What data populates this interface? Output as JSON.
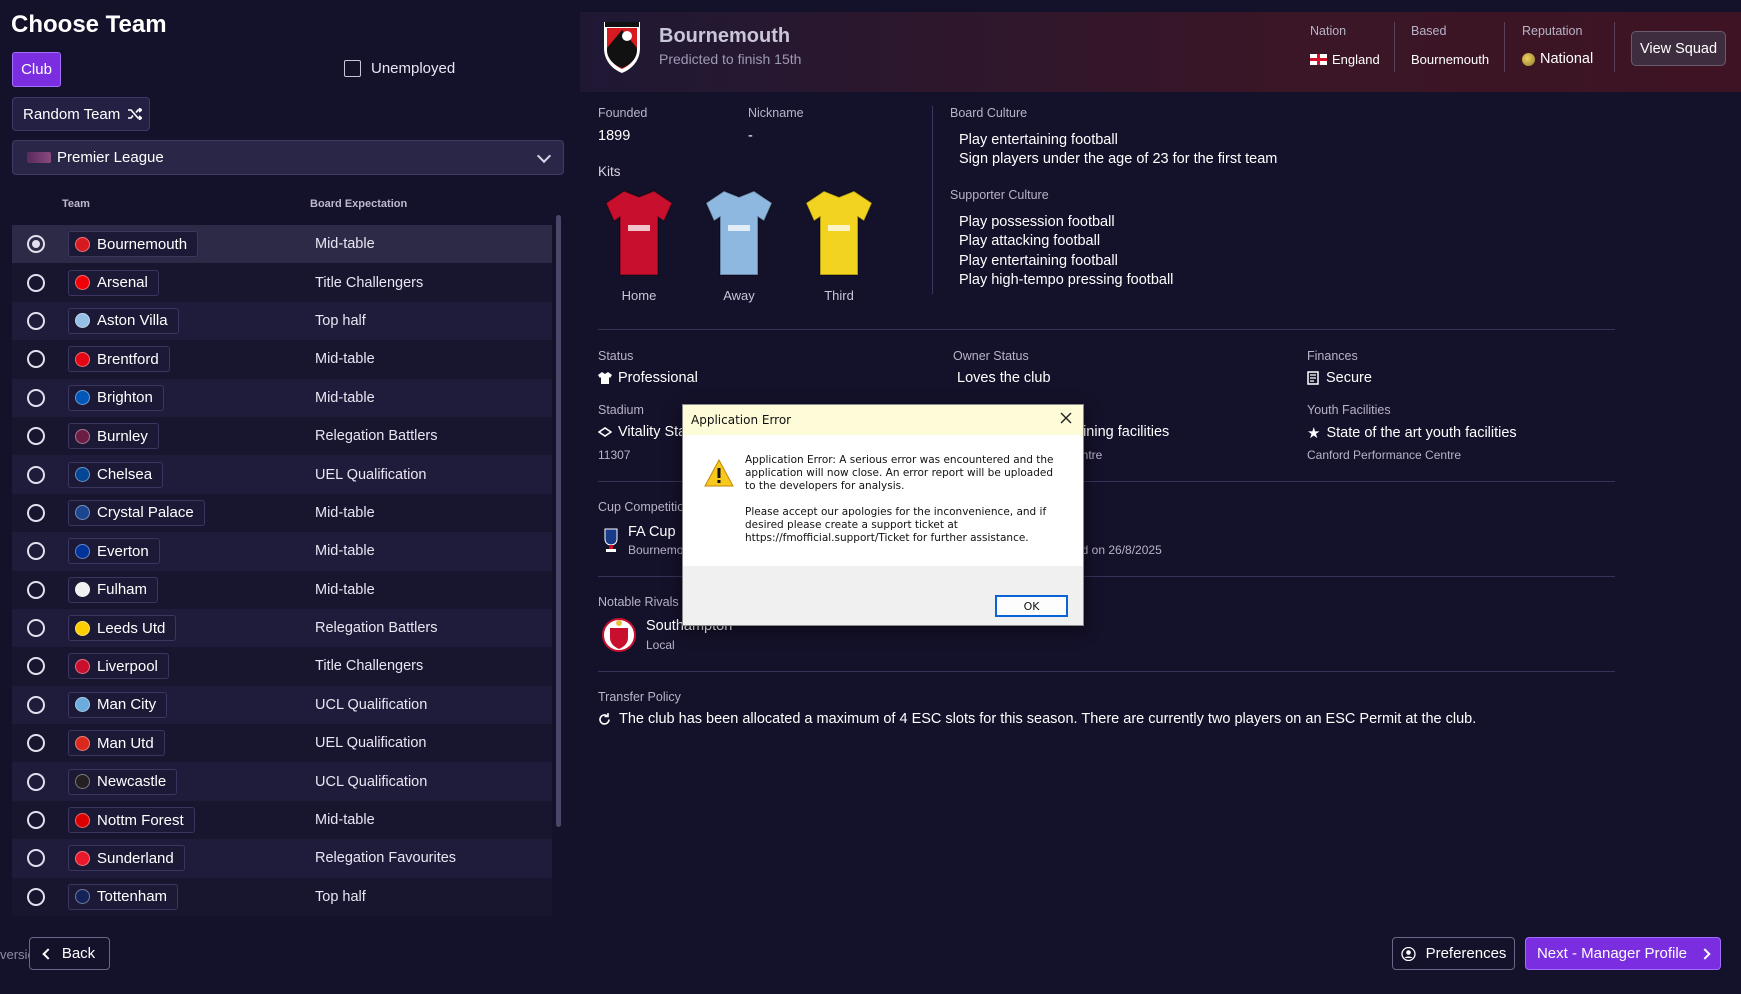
{
  "left": {
    "title": "Choose Team",
    "club_button": "Club",
    "unemployed_label": "Unemployed",
    "random_team_label": "Random Team",
    "league": "Premier League",
    "columns": {
      "team": "Team",
      "expectation": "Board Expectation"
    },
    "teams": [
      {
        "name": "Bournemouth",
        "expectation": "Mid-table",
        "color": "#d71920",
        "selected": true
      },
      {
        "name": "Arsenal",
        "expectation": "Title Challengers",
        "color": "#ef0107"
      },
      {
        "name": "Aston Villa",
        "expectation": "Top half",
        "color": "#95bfe5"
      },
      {
        "name": "Brentford",
        "expectation": "Mid-table",
        "color": "#e30613"
      },
      {
        "name": "Brighton",
        "expectation": "Mid-table",
        "color": "#0057b8"
      },
      {
        "name": "Burnley",
        "expectation": "Relegation Battlers",
        "color": "#6c1d45"
      },
      {
        "name": "Chelsea",
        "expectation": "UEL Qualification",
        "color": "#034694"
      },
      {
        "name": "Crystal Palace",
        "expectation": "Mid-table",
        "color": "#1b458f"
      },
      {
        "name": "Everton",
        "expectation": "Mid-table",
        "color": "#003399"
      },
      {
        "name": "Fulham",
        "expectation": "Mid-table",
        "color": "#f0f0f0"
      },
      {
        "name": "Leeds Utd",
        "expectation": "Relegation Battlers",
        "color": "#ffcd00"
      },
      {
        "name": "Liverpool",
        "expectation": "Title Challengers",
        "color": "#c8102e"
      },
      {
        "name": "Man City",
        "expectation": "UCL Qualification",
        "color": "#6cabdd"
      },
      {
        "name": "Man Utd",
        "expectation": "UEL Qualification",
        "color": "#da291c"
      },
      {
        "name": "Newcastle",
        "expectation": "UCL Qualification",
        "color": "#241f20"
      },
      {
        "name": "Nottm Forest",
        "expectation": "Mid-table",
        "color": "#dd0000"
      },
      {
        "name": "Sunderland",
        "expectation": "Relegation Favourites",
        "color": "#eb172b"
      },
      {
        "name": "Tottenham",
        "expectation": "Top half",
        "color": "#132257"
      }
    ],
    "version_label": "version",
    "back_label": "Back"
  },
  "header": {
    "club_name": "Bournemouth",
    "prediction": "Predicted to finish 15th",
    "nation_label": "Nation",
    "nation_value": "England",
    "based_label": "Based",
    "based_value": "Bournemouth",
    "reputation_label": "Reputation",
    "reputation_value": "National",
    "view_squad": "View Squad"
  },
  "details": {
    "founded_label": "Founded",
    "founded_value": "1899",
    "nickname_label": "Nickname",
    "nickname_value": "-",
    "kits_label": "Kits",
    "kits": [
      {
        "label": "Home",
        "color": "#c8102e"
      },
      {
        "label": "Away",
        "color": "#8fb8e0"
      },
      {
        "label": "Third",
        "color": "#f2d320"
      }
    ],
    "board_culture_label": "Board Culture",
    "board_culture": [
      "Play entertaining football",
      "Sign players under the age of 23 for the first team"
    ],
    "supporter_culture_label": "Supporter Culture",
    "supporter_culture": [
      "Play possession football",
      "Play attacking football",
      "Play entertaining football",
      "Play high-tempo pressing football"
    ],
    "status_label": "Status",
    "status_value": "Professional",
    "owner_label": "Owner Status",
    "owner_value": "Loves the club",
    "finances_label": "Finances",
    "finances_value": "Secure",
    "stadium_label": "Stadium",
    "stadium_value": "Vitality Sta",
    "stadium_capacity": "11307",
    "training_value": "aining facilities",
    "training_sub": "entre",
    "youth_label": "Youth Facilities",
    "youth_value": "State of the art youth facilities",
    "youth_sub": "Canford Performance Centre",
    "cup_label": "Cup Competitio",
    "cup_name": "FA Cup",
    "cup_sub": "Bournemo",
    "cup_date": "nd on 26/8/2025",
    "rivals_label": "Notable Rivals",
    "rival_name": "Southampton",
    "rival_type": "Local",
    "transfer_label": "Transfer Policy",
    "transfer_text": "The club has been allocated a maximum of 4 ESC slots for this season. There are currently two players on an ESC Permit at the club."
  },
  "dialog": {
    "title": "Application Error",
    "message1": "Application Error: A serious error was encountered and the application will now close. An error report will be uploaded to the developers for analysis.",
    "message2": "Please accept our apologies for the inconvenience, and if desired please create a support ticket at https://fmofficial.support/Ticket for further assistance.",
    "ok": "OK"
  },
  "footer": {
    "preferences": "Preferences",
    "next": "Next - Manager Profile"
  },
  "colors": {
    "accent": "#7a2ee0",
    "background": "#14112a",
    "bournemouth_red": "#d71920"
  }
}
